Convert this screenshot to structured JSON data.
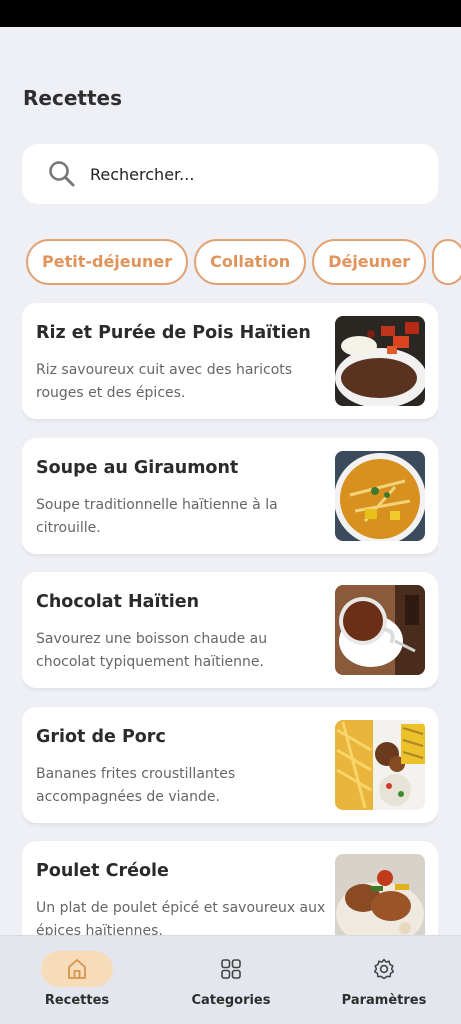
{
  "header": {
    "title": "Recettes"
  },
  "search": {
    "placeholder": "Rechercher..."
  },
  "categories": [
    "Petit-déjeuner",
    "Collation",
    "Déjeuner",
    ""
  ],
  "recipes": [
    {
      "title": "Riz et Purée de Pois Haïtien",
      "description": "Riz savoureux cuit avec des haricots rouges et des épices."
    },
    {
      "title": "Soupe au Giraumont",
      "description": "Soupe traditionnelle haïtienne à la citrouille."
    },
    {
      "title": "Chocolat Haïtien",
      "description": "Savourez une boisson chaude au chocolat typiquement haïtienne."
    },
    {
      "title": "Griot de Porc",
      "description": "Bananes frites croustillantes accompagnées de viande."
    },
    {
      "title": "Poulet Créole",
      "description": "Un plat de poulet épicé et savoureux aux épices haïtiennes."
    }
  ],
  "nav": {
    "items": [
      {
        "label": "Recettes",
        "icon": "home-icon",
        "active": true
      },
      {
        "label": "Categories",
        "icon": "grid-icon",
        "active": false
      },
      {
        "label": "Paramètres",
        "icon": "gear-icon",
        "active": false
      }
    ]
  },
  "colors": {
    "accent": "#e0935a",
    "chip_border": "#e2a271",
    "active_nav_bg": "#f6dcb8",
    "background": "#eef0f6"
  }
}
